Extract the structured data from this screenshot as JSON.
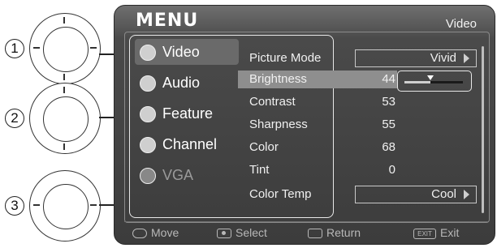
{
  "callouts": [
    {
      "number": "1"
    },
    {
      "number": "2"
    },
    {
      "number": "3"
    }
  ],
  "menu": {
    "title": "MENU",
    "current_section": "Video"
  },
  "sidebar": {
    "items": [
      {
        "label": "Video",
        "icon": "tv-icon",
        "state": "selected"
      },
      {
        "label": "Audio",
        "icon": "speaker-icon",
        "state": "normal"
      },
      {
        "label": "Feature",
        "icon": "wrench-icon",
        "state": "normal"
      },
      {
        "label": "Channel",
        "icon": "satellite-dish-icon",
        "state": "normal"
      },
      {
        "label": "VGA",
        "icon": "monitor-icon",
        "state": "disabled"
      }
    ]
  },
  "settings": {
    "picture_mode": {
      "label": "Picture Mode",
      "value": "Vivid"
    },
    "brightness": {
      "label": "Brightness",
      "value": "44",
      "level": 0.44
    },
    "contrast": {
      "label": "Contrast",
      "value": "53"
    },
    "sharpness": {
      "label": "Sharpness",
      "value": "55"
    },
    "color": {
      "label": "Color",
      "value": "68"
    },
    "tint": {
      "label": "Tint",
      "value": "0"
    },
    "color_temp": {
      "label": "Color Temp",
      "value": "Cool"
    }
  },
  "footer": {
    "move": "Move",
    "select": "Select",
    "return": "Return",
    "exit": "Exit",
    "exit_key": "EXIT"
  }
}
